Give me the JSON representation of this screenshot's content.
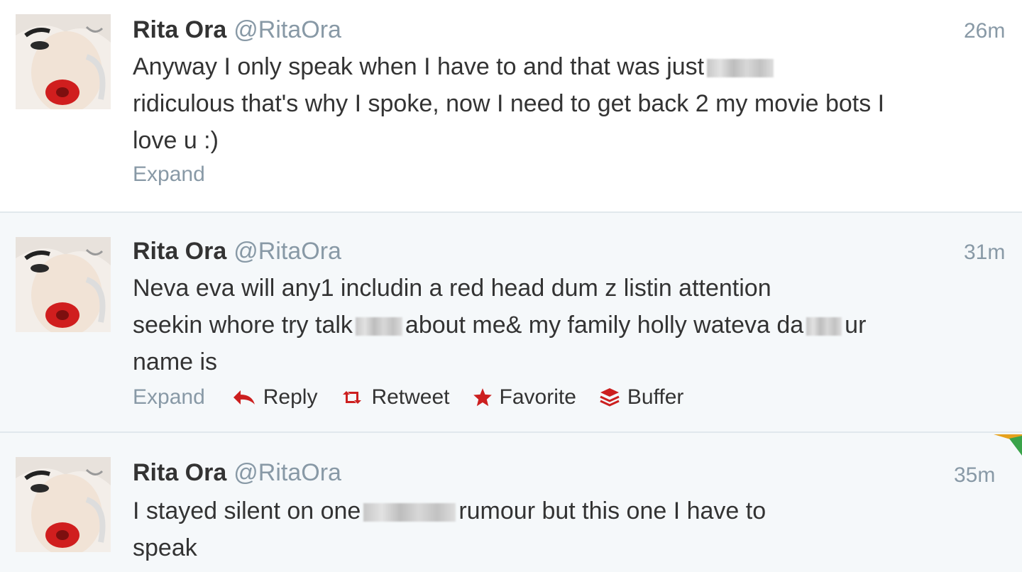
{
  "tweets": [
    {
      "name": "Rita Ora",
      "handle": "@RitaOra",
      "time": "26m",
      "text_lines": [
        "Anyway I only speak when I have to and that was just",
        "ridiculous that's why I spoke, now I need to get back 2 my movie bots I",
        "love u :)"
      ],
      "expand": "Expand"
    },
    {
      "name": "Rita Ora",
      "handle": "@RitaOra",
      "time": "31m",
      "text_lines": [
        "Neva eva will any1 includin a red head dum z listin attention",
        "seekin whore try talk",
        "about me& my family holly wateva da",
        "ur",
        "name is"
      ],
      "expand": "Expand",
      "actions": {
        "reply": "Reply",
        "retweet": "Retweet",
        "favorite": "Favorite",
        "buffer": "Buffer"
      }
    },
    {
      "name": "Rita Ora",
      "handle": "@RitaOra",
      "time": "35m",
      "text_lines": [
        "I stayed silent on one",
        "rumour but this one I have to",
        "speak"
      ]
    }
  ],
  "colors": {
    "text": "#333333",
    "muted": "#8899a6",
    "action_icon": "#cc1f1f",
    "divider": "#e1e8ed",
    "hover_bg": "#f5f8fa"
  }
}
